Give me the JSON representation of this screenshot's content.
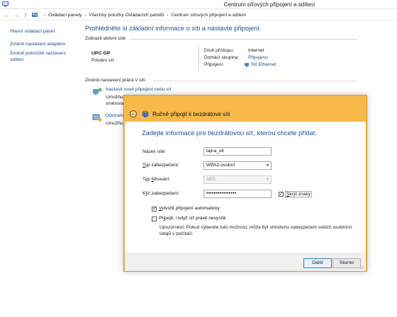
{
  "window": {
    "title": "Centrum síťových připojení a sdílení"
  },
  "address_bar": {
    "back_symbol": "←",
    "forward_symbol": "→",
    "up_symbol": "↑",
    "crumbs": [
      "Ovládací panely",
      "Všechny položky Ovládacích panelů",
      "Centrum síťových připojení a sdílení"
    ],
    "separator": "›"
  },
  "sidebar": {
    "items": [
      {
        "label": "Hlavní ovládací panel"
      },
      {
        "label": "Změnit nastavení adaptéru"
      },
      {
        "label_line1": "Změnit pokročilé nastavení",
        "label_line2": "sdílení"
      }
    ]
  },
  "main": {
    "title": "Prohlédněte si základní informace o síti a nastavte připojení.",
    "active_networks_label": "Zobrazit aktivní sítě",
    "network_name": "UPC-GP",
    "network_type": "Privátní síť",
    "access_type_label": "Druh přístupu:",
    "access_type_value": "Internet",
    "homegroup_label": "Domácí skupina:",
    "homegroup_value": "Připojeno",
    "connections_label": "Připojení:",
    "connections_value": "Síť Ethernet",
    "change_settings_label": "Změnit nastavení práce v síti",
    "task1_link": "Nastavit nové připojení nebo síť",
    "task1_desc_line1": "Umožňuj",
    "task1_desc_line2": "směrovač",
    "task2_link": "Odstranit",
    "task2_desc_line1": "Umožňuj"
  },
  "dialog": {
    "title": "Ručně připojit k bezdrátové síti",
    "back_symbol": "←",
    "heading": "Zadejte informace pro bezdrátovou síť, kterou chcete přidat.",
    "network_name_label": "Název sítě:",
    "network_name_value": "tajna_sit",
    "security_type_label_u": "T",
    "security_type_label_rest": "yp zabezpečení:",
    "security_type_value": "WPA2-osobní",
    "encryption_type_label_pre": "Typ ",
    "encryption_type_label_u": "š",
    "encryption_type_label_rest": "ifrování:",
    "encryption_type_value": "AES",
    "security_key_label_pre": "K",
    "security_key_label_u": "l",
    "security_key_label_rest": "íč zabezpečení:",
    "security_key_value": "••••••••••••••••",
    "hide_chars_label_u": "S",
    "hide_chars_label_rest": "krýt znaky",
    "hide_chars_checked": true,
    "auto_connect_label_u": "V",
    "auto_connect_label_rest": "ytvořit připojení automaticky",
    "auto_connect_checked": true,
    "connect_even_if_not_broadcasting_label_pre": "Př",
    "connect_even_if_not_broadcasting_label_u": "i",
    "connect_even_if_not_broadcasting_label_rest": "pojit, i když síť právě nevysílá",
    "connect_even_checked": false,
    "warning_line1": "Upozornění: Pokud vyberete tuto možnost, může být ohroženo zabezpečení vašich osobních",
    "warning_line2": "údajů v počítači.",
    "next_button": "Další",
    "cancel_button": "Storno",
    "check_mark": "✓",
    "dropdown_arrow": "▾"
  },
  "colors": {
    "dialog_frame": "#f6b94a",
    "link": "#1a4a8e",
    "heading": "#1e50a2"
  }
}
